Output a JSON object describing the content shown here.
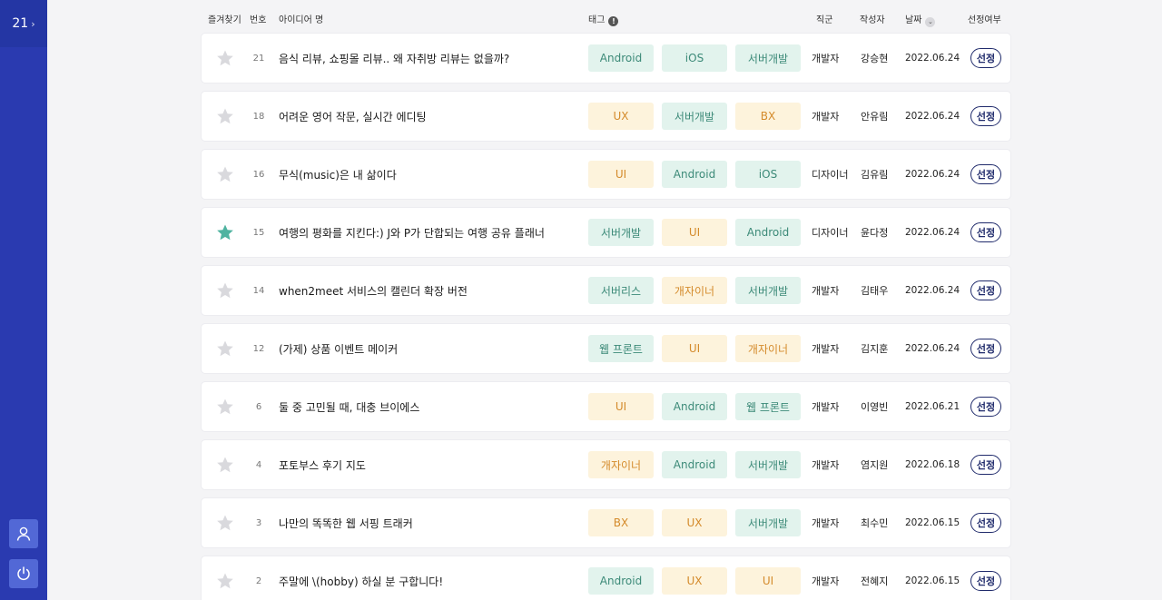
{
  "sidebar": {
    "count": "21",
    "chevron": "›"
  },
  "header": {
    "favorite": "즐겨찾기",
    "number": "번호",
    "idea_name": "아이디어 명",
    "tag": "태그",
    "role": "직군",
    "author": "작성자",
    "date": "날짜",
    "selection": "선정여부"
  },
  "colors": {
    "sidebar": "#2a3ab0",
    "tag_green_bg": "#e2f3ed",
    "tag_green_text": "#3c8a78",
    "tag_yellow_bg": "#fdf3dc",
    "tag_yellow_text": "#d48a2a",
    "star_active": "#4fb3a0",
    "star_inactive": "#d9d9dd",
    "button_border": "#1f2a6b"
  },
  "select_label": "선정",
  "rows": [
    {
      "num": "21",
      "starred": false,
      "title": "음식 리뷰, 쇼핑몰 리뷰.. 왜 자취방 리뷰는 없을까?",
      "tags": [
        {
          "label": "Android",
          "color": "green"
        },
        {
          "label": "iOS",
          "color": "green"
        },
        {
          "label": "서버개발",
          "color": "green"
        }
      ],
      "role": "개발자",
      "author": "강승현",
      "date": "2022.06.24"
    },
    {
      "num": "18",
      "starred": false,
      "title": "어려운 영어 작문, 실시간 에디팅",
      "tags": [
        {
          "label": "UX",
          "color": "yellow"
        },
        {
          "label": "서버개발",
          "color": "green"
        },
        {
          "label": "BX",
          "color": "yellow"
        }
      ],
      "role": "개발자",
      "author": "안유림",
      "date": "2022.06.24"
    },
    {
      "num": "16",
      "starred": false,
      "title": "무식(music)은 내 삶이다",
      "tags": [
        {
          "label": "UI",
          "color": "yellow"
        },
        {
          "label": "Android",
          "color": "green"
        },
        {
          "label": "iOS",
          "color": "green"
        }
      ],
      "role": "디자이너",
      "author": "김유림",
      "date": "2022.06.24"
    },
    {
      "num": "15",
      "starred": true,
      "title": "여행의 평화를 지킨다:) J와 P가 단합되는 여행 공유 플래너",
      "tags": [
        {
          "label": "서버개발",
          "color": "green"
        },
        {
          "label": "UI",
          "color": "yellow"
        },
        {
          "label": "Android",
          "color": "green"
        }
      ],
      "role": "디자이너",
      "author": "윤다정",
      "date": "2022.06.24"
    },
    {
      "num": "14",
      "starred": false,
      "title": "when2meet 서비스의 캘린더 확장 버전",
      "tags": [
        {
          "label": "서버리스",
          "color": "green"
        },
        {
          "label": "개자이너",
          "color": "yellow"
        },
        {
          "label": "서버개발",
          "color": "green"
        }
      ],
      "role": "개발자",
      "author": "김태우",
      "date": "2022.06.24"
    },
    {
      "num": "12",
      "starred": false,
      "title": "(가제) 상품 이벤트 메이커",
      "tags": [
        {
          "label": "웹 프론트",
          "color": "green"
        },
        {
          "label": "UI",
          "color": "yellow"
        },
        {
          "label": "개자이너",
          "color": "yellow"
        }
      ],
      "role": "개발자",
      "author": "김지훈",
      "date": "2022.06.24"
    },
    {
      "num": "6",
      "starred": false,
      "title": "둘 중 고민될 때, 대충 브이에스",
      "tags": [
        {
          "label": "UI",
          "color": "yellow"
        },
        {
          "label": "Android",
          "color": "green"
        },
        {
          "label": "웹 프론트",
          "color": "green"
        }
      ],
      "role": "개발자",
      "author": "이영빈",
      "date": "2022.06.21"
    },
    {
      "num": "4",
      "starred": false,
      "title": "포토부스 후기 지도",
      "tags": [
        {
          "label": "개자이너",
          "color": "yellow"
        },
        {
          "label": "Android",
          "color": "green"
        },
        {
          "label": "서버개발",
          "color": "green"
        }
      ],
      "role": "개발자",
      "author": "염지원",
      "date": "2022.06.18"
    },
    {
      "num": "3",
      "starred": false,
      "title": "나만의 똑똑한 웹 서핑 트래커",
      "tags": [
        {
          "label": "BX",
          "color": "yellow"
        },
        {
          "label": "UX",
          "color": "yellow"
        },
        {
          "label": "서버개발",
          "color": "green"
        }
      ],
      "role": "개발자",
      "author": "최수민",
      "date": "2022.06.15"
    },
    {
      "num": "2",
      "starred": false,
      "title": "주말에 \\(hobby) 하실 분 구합니다!",
      "tags": [
        {
          "label": "Android",
          "color": "green"
        },
        {
          "label": "UX",
          "color": "yellow"
        },
        {
          "label": "UI",
          "color": "yellow"
        }
      ],
      "role": "개발자",
      "author": "전혜지",
      "date": "2022.06.15"
    }
  ]
}
